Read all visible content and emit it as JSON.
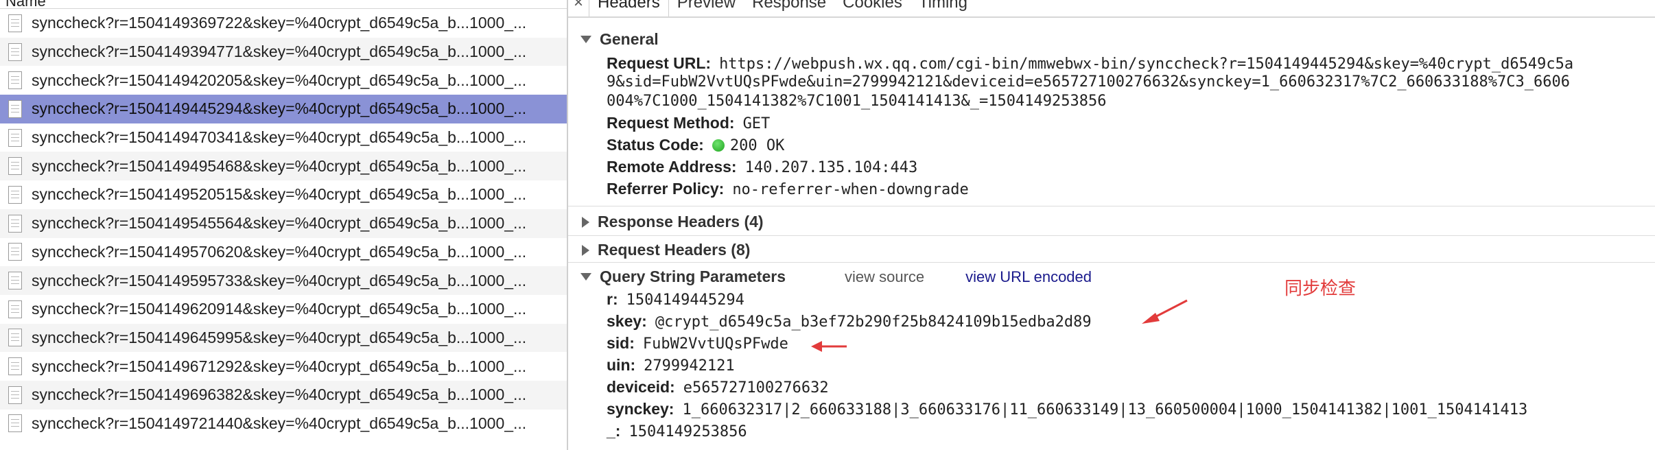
{
  "left_panel": {
    "header": "Name",
    "rows": [
      "synccheck?r=1504149369722&skey=%40crypt_d6549c5a_b...1000_...",
      "synccheck?r=1504149394771&skey=%40crypt_d6549c5a_b...1000_...",
      "synccheck?r=1504149420205&skey=%40crypt_d6549c5a_b...1000_...",
      "synccheck?r=1504149445294&skey=%40crypt_d6549c5a_b...1000_...",
      "synccheck?r=1504149470341&skey=%40crypt_d6549c5a_b...1000_...",
      "synccheck?r=1504149495468&skey=%40crypt_d6549c5a_b...1000_...",
      "synccheck?r=1504149520515&skey=%40crypt_d6549c5a_b...1000_...",
      "synccheck?r=1504149545564&skey=%40crypt_d6549c5a_b...1000_...",
      "synccheck?r=1504149570620&skey=%40crypt_d6549c5a_b...1000_...",
      "synccheck?r=1504149595733&skey=%40crypt_d6549c5a_b...1000_...",
      "synccheck?r=1504149620914&skey=%40crypt_d6549c5a_b...1000_...",
      "synccheck?r=1504149645995&skey=%40crypt_d6549c5a_b...1000_...",
      "synccheck?r=1504149671292&skey=%40crypt_d6549c5a_b...1000_...",
      "synccheck?r=1504149696382&skey=%40crypt_d6549c5a_b...1000_...",
      "synccheck?r=1504149721440&skey=%40crypt_d6549c5a_b...1000_..."
    ],
    "selected_index": 3
  },
  "tabs": {
    "close": "×",
    "items": [
      "Headers",
      "Preview",
      "Response",
      "Cookies",
      "Timing"
    ],
    "active": "Headers"
  },
  "general": {
    "title": "General",
    "request_url_key": "Request URL:",
    "request_url_line1": "https://webpush.wx.qq.com/cgi-bin/mmwebwx-bin/synccheck?r=1504149445294&skey=%40crypt_d6549c5a",
    "request_url_line2": "9&sid=FubW2VvtUQsPFwde&uin=2799942121&deviceid=e565727100276632&synckey=1_660632317%7C2_660633188%7C3_6606",
    "request_url_line3": "004%7C1000_1504141382%7C1001_1504141413&_=1504149253856",
    "method_key": "Request Method:",
    "method_val": "GET",
    "status_key": "Status Code:",
    "status_val": "200 OK",
    "remote_key": "Remote Address:",
    "remote_val": "140.207.135.104:443",
    "referrer_key": "Referrer Policy:",
    "referrer_val": "no-referrer-when-downgrade",
    "status_color": "#22aa22"
  },
  "response_headers": {
    "title": "Response Headers (4)"
  },
  "request_headers": {
    "title": "Request Headers (8)"
  },
  "query": {
    "title": "Query String Parameters",
    "view_source": "view source",
    "view_url_encoded": "view URL encoded",
    "params": [
      {
        "key": "r:",
        "value": "1504149445294"
      },
      {
        "key": "skey:",
        "value": "@crypt_d6549c5a_b3ef72b290f25b8424109b15edba2d89"
      },
      {
        "key": "sid:",
        "value": "FubW2VvtUQsPFwde"
      },
      {
        "key": "uin:",
        "value": "2799942121"
      },
      {
        "key": "deviceid:",
        "value": "e565727100276632"
      },
      {
        "key": "synckey:",
        "value": "1_660632317|2_660633188|3_660633176|11_660633149|13_660500004|1000_1504141382|1001_1504141413"
      },
      {
        "key": "_:",
        "value": "1504149253856"
      }
    ]
  },
  "annotation": {
    "text": "同步检查",
    "color": "#e23b3b"
  }
}
